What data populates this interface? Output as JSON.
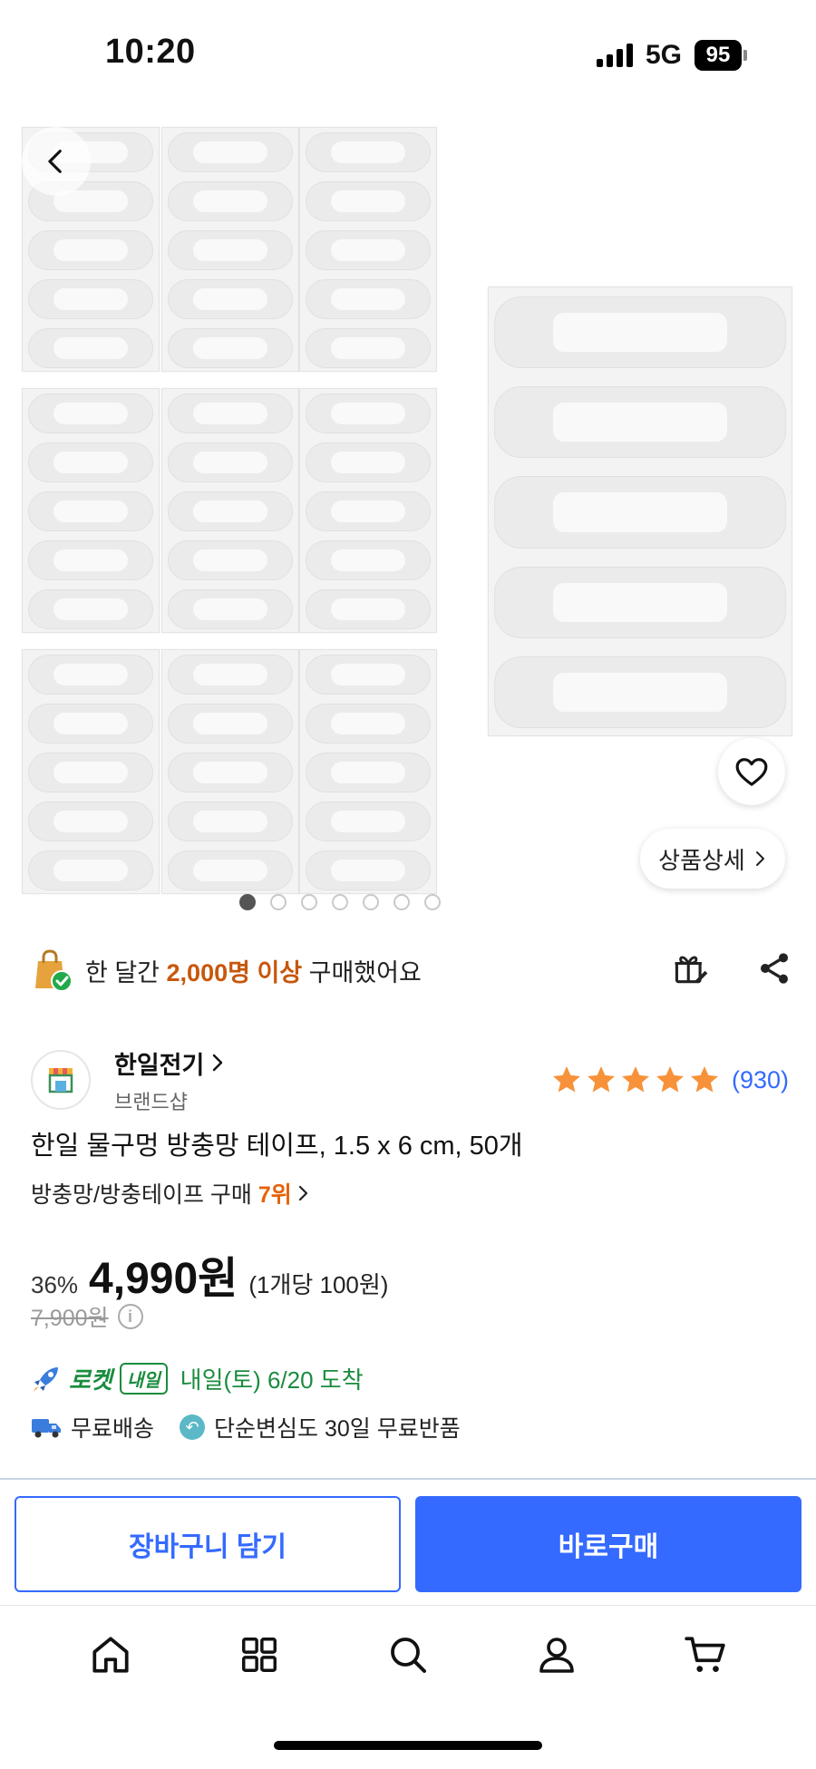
{
  "status": {
    "time": "10:20",
    "network": "5G",
    "battery": "95"
  },
  "gallery": {
    "detail_label": "상품상세",
    "dot_count": 7,
    "active_dot": 0
  },
  "notice": {
    "prefix": "한 달간 ",
    "highlight": "2,000명 이상",
    "suffix": " 구매했어요"
  },
  "seller": {
    "name": "한일전기",
    "sub": "브랜드샵",
    "rating_stars": 5,
    "rating_count": "(930)"
  },
  "product": {
    "title": "한일 물구멍 방충망 테이프, 1.5 x 6 cm, 50개",
    "rank_prefix": "방충망/방충테이프 구매 ",
    "rank_num": "7위"
  },
  "price": {
    "discount": "36%",
    "sale": "4,990원",
    "unit": "(1개당 100원)",
    "original": "7,900원"
  },
  "delivery": {
    "rocket": "로켓",
    "tomorrow": "내일",
    "arrival": "내일(토) 6/20 도착",
    "free_shipping": "무료배송",
    "free_return": "단순변심도 30일 무료반품"
  },
  "actions": {
    "cart": "장바구니 담기",
    "buy": "바로구매"
  },
  "colors": {
    "accent": "#346aff",
    "rocket_green": "#1a8c3e",
    "highlight_orange": "#c7570b"
  }
}
